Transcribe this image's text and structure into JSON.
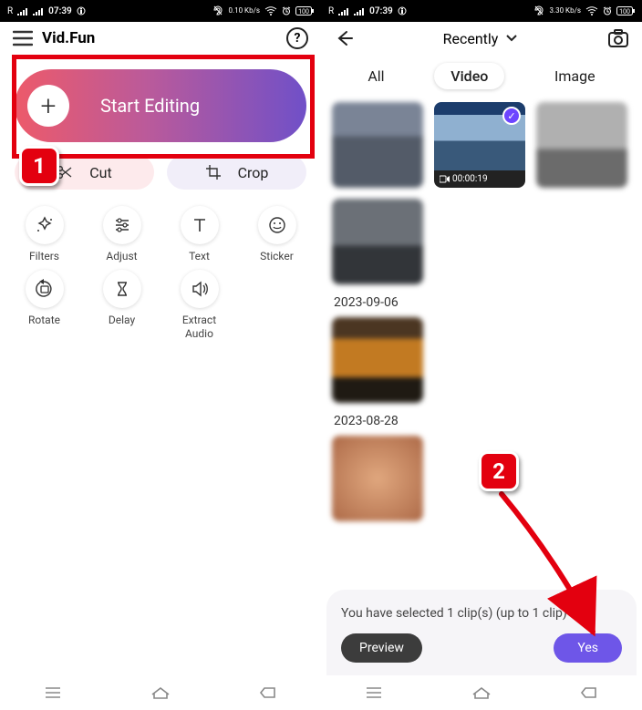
{
  "statusbar": {
    "carrier": "R",
    "time": "07:39",
    "net_rate": "0.10 Kb/s",
    "net_rate2": "3.30 Kb/s",
    "battery": "100"
  },
  "left": {
    "title": "Vid.Fun",
    "start_label": "Start Editing",
    "cut_label": "Cut",
    "crop_label": "Crop",
    "tools": [
      {
        "key": "filters",
        "label": "Filters"
      },
      {
        "key": "adjust",
        "label": "Adjust"
      },
      {
        "key": "text",
        "label": "Text"
      },
      {
        "key": "sticker",
        "label": "Sticker"
      },
      {
        "key": "rotate",
        "label": "Rotate"
      },
      {
        "key": "delay",
        "label": "Delay"
      },
      {
        "key": "extract",
        "label": "Extract\nAudio"
      }
    ]
  },
  "right": {
    "dropdown": "Recently",
    "tabs": {
      "all": "All",
      "video": "Video",
      "image": "Image"
    },
    "selected_duration": "00:00:19",
    "sections": [
      {
        "title": "2023-09-06"
      },
      {
        "title": "2023-08-28"
      }
    ],
    "sheet": {
      "text": "You have selected 1 clip(s) (up to 1 clip)",
      "preview": "Preview",
      "yes": "Yes"
    }
  },
  "anno": {
    "one": "1",
    "two": "2"
  }
}
